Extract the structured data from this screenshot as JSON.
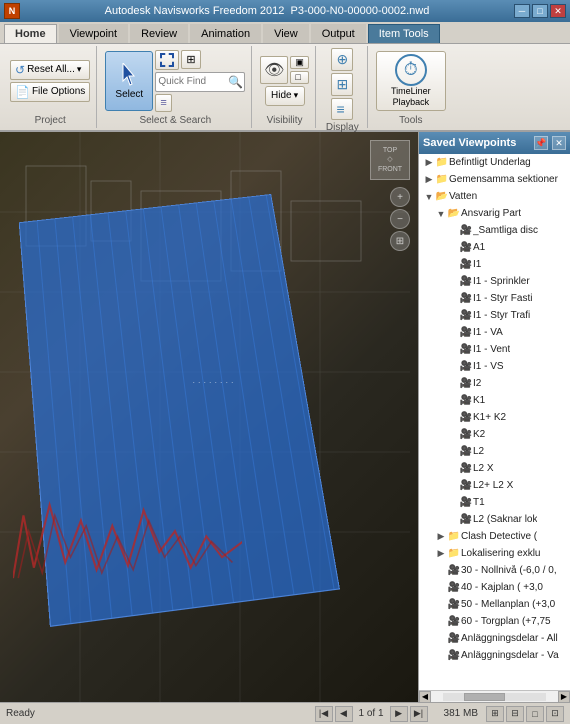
{
  "titlebar": {
    "app_title": "Autodesk Navisworks Freedom 2012",
    "file_name": "P3-000-N0-00000-0002.nwd",
    "min_label": "─",
    "max_label": "□",
    "close_label": "✕"
  },
  "ribbon": {
    "tabs": [
      {
        "id": "home",
        "label": "Home",
        "active": true
      },
      {
        "id": "viewpoint",
        "label": "Viewpoint"
      },
      {
        "id": "review",
        "label": "Review"
      },
      {
        "id": "animation",
        "label": "Animation"
      },
      {
        "id": "view",
        "label": "View"
      },
      {
        "id": "output",
        "label": "Output"
      },
      {
        "id": "item-tools",
        "label": "Item Tools",
        "special": true
      }
    ],
    "groups": {
      "project": {
        "label": "Project",
        "reset_all": "Reset All...",
        "file_options": "File Options"
      },
      "select_search": {
        "label": "Select & Search",
        "select": "Select",
        "quick_find_placeholder": "Quick Find"
      },
      "visibility": {
        "label": "Visibility",
        "hide": "Hide"
      },
      "display": {
        "label": "Display"
      },
      "tools": {
        "label": "Tools",
        "timeliner_playback": "TimeLiner Playback"
      }
    }
  },
  "saved_viewpoints_panel": {
    "title": "Saved Viewpoints",
    "tree_items": [
      {
        "id": "befintligt",
        "label": "Befintligt Underlag",
        "level": 1,
        "type": "folder",
        "expanded": false
      },
      {
        "id": "gemensamma",
        "label": "Gemensamma sektioner",
        "level": 1,
        "type": "folder",
        "expanded": false
      },
      {
        "id": "vatten",
        "label": "Vatten",
        "level": 1,
        "type": "folder",
        "expanded": true
      },
      {
        "id": "ansvarig",
        "label": "Ansvarig Part",
        "level": 2,
        "type": "folder",
        "expanded": true
      },
      {
        "id": "samtliga",
        "label": "_Samtliga disc",
        "level": 3,
        "type": "file"
      },
      {
        "id": "a1",
        "label": "A1",
        "level": 3,
        "type": "file"
      },
      {
        "id": "i1",
        "label": "I1",
        "level": 3,
        "type": "file"
      },
      {
        "id": "i1_sprinkler",
        "label": "I1 - Sprinkler",
        "level": 3,
        "type": "file"
      },
      {
        "id": "i1_styr_fasti",
        "label": "I1 - Styr Fasti",
        "level": 3,
        "type": "file"
      },
      {
        "id": "i1_styr_trafi",
        "label": "I1 - Styr Trafi",
        "level": 3,
        "type": "file"
      },
      {
        "id": "i1_va",
        "label": "I1 - VA",
        "level": 3,
        "type": "file"
      },
      {
        "id": "i1_vent",
        "label": "I1 - Vent",
        "level": 3,
        "type": "file"
      },
      {
        "id": "i1_vs",
        "label": "I1 - VS",
        "level": 3,
        "type": "file"
      },
      {
        "id": "i2",
        "label": "I2",
        "level": 3,
        "type": "file"
      },
      {
        "id": "k1",
        "label": "K1",
        "level": 3,
        "type": "file"
      },
      {
        "id": "k1k2",
        "label": "K1+ K2",
        "level": 3,
        "type": "file"
      },
      {
        "id": "k2",
        "label": "K2",
        "level": 3,
        "type": "file"
      },
      {
        "id": "l2",
        "label": "L2",
        "level": 3,
        "type": "file"
      },
      {
        "id": "l2x",
        "label": "L2 X",
        "level": 3,
        "type": "file"
      },
      {
        "id": "l2l2x",
        "label": "L2+ L2 X",
        "level": 3,
        "type": "file"
      },
      {
        "id": "t1",
        "label": "T1",
        "level": 3,
        "type": "file"
      },
      {
        "id": "l2_saknar",
        "label": "L2 (Saknar lok",
        "level": 3,
        "type": "file"
      },
      {
        "id": "clash_detective",
        "label": "Clash Detective (",
        "level": 2,
        "type": "folder",
        "expanded": false
      },
      {
        "id": "lokalisering",
        "label": "Lokalisering exklu",
        "level": 2,
        "type": "folder",
        "expanded": false
      },
      {
        "id": "nollniva",
        "label": "30 - Nollnivå (-6,0 / 0,",
        "level": 2,
        "type": "file"
      },
      {
        "id": "kajplan",
        "label": "40 - Kajplan ( +3,0",
        "level": 2,
        "type": "file"
      },
      {
        "id": "mellanplan",
        "label": "50 - Mellanplan (+3,0",
        "level": 2,
        "type": "file"
      },
      {
        "id": "torgplan",
        "label": "60 - Torgplan (+7,75",
        "level": 2,
        "type": "file"
      },
      {
        "id": "anlaggning_all",
        "label": "Anläggningsdelar - All",
        "level": 2,
        "type": "file"
      },
      {
        "id": "anlaggning_va",
        "label": "Anläggningsdelar - Va",
        "level": 2,
        "type": "file"
      }
    ]
  },
  "statusbar": {
    "ready": "Ready",
    "page_info": "1 of 1",
    "memory": "381 MB"
  }
}
